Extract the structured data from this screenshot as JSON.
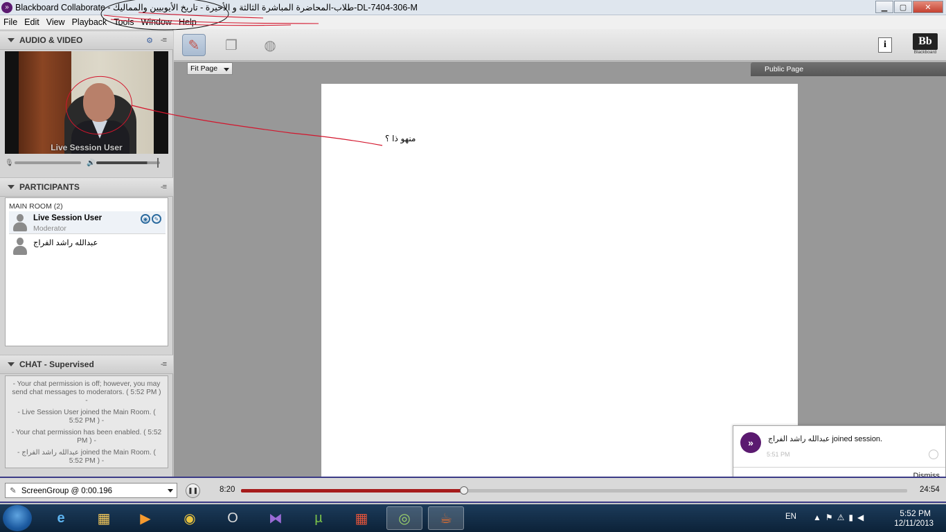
{
  "titlebar": {
    "title": "Blackboard Collaborate - طلاب-المحاضرة المباشرة الثالثة و الأخيرة - تاريخ الأيوبيين والمماليك-DL-7404-306-M",
    "min": "▁",
    "max": "▢",
    "close": "✕"
  },
  "menubar": [
    "File",
    "Edit",
    "View",
    "Playback",
    "Tools",
    "Window",
    "Help"
  ],
  "audio_video": {
    "title": "AUDIO & VIDEO",
    "caption": "Live Session User",
    "mic_level": 0.8
  },
  "participants": {
    "title": "PARTICIPANTS",
    "room": "MAIN ROOM  (2)",
    "list": [
      {
        "name": "Live Session User",
        "role": "Moderator"
      },
      {
        "name": "عبدالله راشد الفراج",
        "role": ""
      }
    ]
  },
  "chat": {
    "title": "CHAT - Supervised",
    "messages": [
      "- Your chat permission is off; however, you may send chat messages to moderators. ( 5:52 PM ) -",
      "- Live Session User joined the Main Room. ( 5:52 PM ) -",
      "- Your chat permission has been enabled. ( 5:52 PM ) -",
      "- عبدالله راشد الفراج joined the Main Room. ( 5:52 PM ) -"
    ]
  },
  "whiteboard": {
    "zoom": "Fit Page",
    "page_tab": "Public Page",
    "text": "منهو ذا ؟"
  },
  "toolbar": {
    "info": "i",
    "brand_logo": "Bb",
    "brand_text": "Blackboard"
  },
  "notification": {
    "message": "عبدالله راشد الفراج joined session.",
    "time": "5:51 PM",
    "dismiss": "Dismiss"
  },
  "playback": {
    "source": "ScreenGroup @ 0:00.196",
    "elapsed": "8:20",
    "total": "24:54",
    "progress": 0.3347
  },
  "taskbar": {
    "lang": "EN",
    "time": "5:52 PM",
    "date": "12/11/2013",
    "icons": [
      "ie-icon",
      "explorer-icon",
      "media-player-icon",
      "chrome-icon",
      "opera-icon",
      "visual-studio-icon",
      "utorrent-icon",
      "apps-icon",
      "network-tool-icon",
      "java-icon"
    ]
  },
  "colors": {
    "accent_purple": "#5b1a70",
    "progress_red": "#a61c1c",
    "playback_border": "#3a3a86",
    "annotation_red": "#d3152c"
  }
}
